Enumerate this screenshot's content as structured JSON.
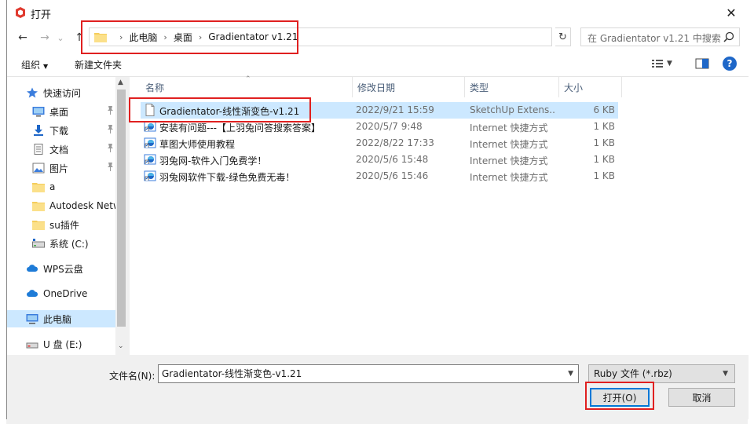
{
  "window": {
    "title": "打开",
    "close_glyph": "✕"
  },
  "nav": {
    "back": "←",
    "forward": "→",
    "up": "↑",
    "recent": "⌄"
  },
  "address": {
    "crumbs": [
      "此电脑",
      "桌面",
      "Gradientator v1.21"
    ],
    "separator": "›",
    "dropdown": "⌄",
    "refresh": "↻"
  },
  "search": {
    "placeholder": "在 Gradientator v1.21 中搜索"
  },
  "toolbar": {
    "organize": "组织",
    "new_folder": "新建文件夹",
    "help": "?"
  },
  "sidebar": {
    "items": [
      {
        "label": "快速访问",
        "icon": "star-icon"
      },
      {
        "label": "桌面",
        "icon": "desktop-icon",
        "pinned": true
      },
      {
        "label": "下载",
        "icon": "download-icon",
        "pinned": true
      },
      {
        "label": "文档",
        "icon": "document-icon",
        "pinned": true
      },
      {
        "label": "图片",
        "icon": "picture-icon",
        "pinned": true
      },
      {
        "label": "a",
        "icon": "folder-icon"
      },
      {
        "label": "Autodesk Netw",
        "icon": "folder-icon"
      },
      {
        "label": "su插件",
        "icon": "folder-icon"
      },
      {
        "label": "系统 (C:)",
        "icon": "drive-icon"
      },
      {
        "label": "WPS云盘",
        "icon": "cloud-icon"
      },
      {
        "label": "OneDrive",
        "icon": "cloud-icon"
      },
      {
        "label": "此电脑",
        "icon": "computer-icon",
        "selected": true
      },
      {
        "label": "U 盘 (E:)",
        "icon": "usb-drive-icon"
      }
    ],
    "pin_glyph": "📌"
  },
  "columns": {
    "name": "名称",
    "modified": "修改日期",
    "type": "类型",
    "size": "大小"
  },
  "files": [
    {
      "name": "Gradientator-线性渐变色-v1.21",
      "modified": "2022/9/21 15:59",
      "type": "SketchUp Extens...",
      "size": "6 KB",
      "icon": "file-icon",
      "selected": true
    },
    {
      "name": "安装有问题---【上羽兔问答搜索答案】",
      "modified": "2020/5/7 9:48",
      "type": "Internet 快捷方式",
      "size": "1 KB",
      "icon": "internet-shortcut-icon"
    },
    {
      "name": "草图大师使用教程",
      "modified": "2022/8/22 17:33",
      "type": "Internet 快捷方式",
      "size": "1 KB",
      "icon": "internet-shortcut-icon"
    },
    {
      "name": "羽兔网-软件入门免费学！",
      "modified": "2020/5/6 15:48",
      "type": "Internet 快捷方式",
      "size": "1 KB",
      "icon": "internet-shortcut-icon"
    },
    {
      "name": "羽兔网软件下载-绿色免费无毒！",
      "modified": "2020/5/6 15:46",
      "type": "Internet 快捷方式",
      "size": "1 KB",
      "icon": "internet-shortcut-icon"
    }
  ],
  "footer": {
    "filename_label": "文件名(N):",
    "filename_value": "Gradientator-线性渐变色-v1.21",
    "filetype": "Ruby 文件 (*.rbz)",
    "open": "打开(O)",
    "cancel": "取消"
  },
  "colors": {
    "accent": "#0078d7",
    "highlight": "#e02020",
    "selection": "#cce8ff"
  }
}
